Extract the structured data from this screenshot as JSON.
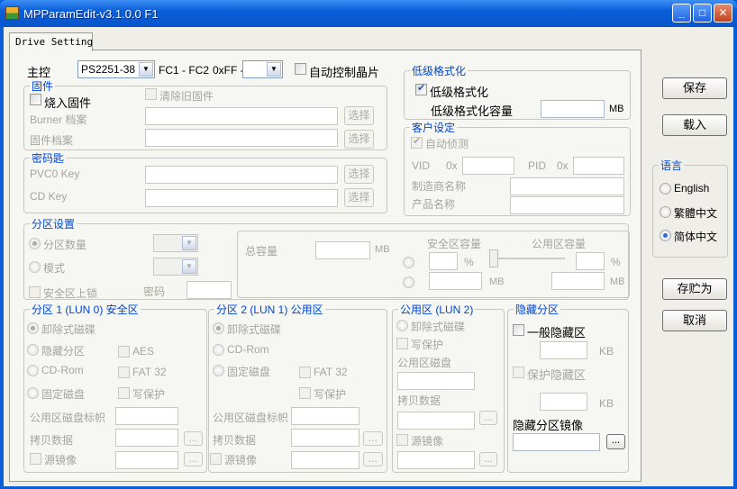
{
  "window": {
    "title": "MPParamEdit-v3.1.0.0 F1",
    "minimize": "_",
    "maximize": "□",
    "close": "✕"
  },
  "tab": "Drive Setting",
  "controller": {
    "label": "主控",
    "value": "PS2251-38",
    "fc_label": "FC1 - FC2",
    "ff_label": "0xFF -",
    "ff_value": "",
    "auto_chip": "自动控制晶片"
  },
  "firmware": {
    "title": "固件",
    "burn": "烧入固件",
    "clear": "清除旧固件",
    "burner_label": "Burner 档案",
    "fw_label": "固件档案",
    "select": "选择"
  },
  "key": {
    "title": "密码匙",
    "pvc0": "PVC0 Key",
    "cd": "CD Key",
    "select": "选择"
  },
  "lowformat": {
    "title": "低级格式化",
    "check": "低级格式化",
    "cap_label": "低级格式化容量",
    "unit": "MB",
    "checked": true
  },
  "customer": {
    "title": "客户设定",
    "auto": "自动侦测",
    "vid": "VID",
    "pid": "PID",
    "hex": "0x",
    "maker": "制造商名称",
    "product": "产品名称"
  },
  "buttons": {
    "save": "保存",
    "load": "载入",
    "saveas": "存贮为",
    "cancel": "取消"
  },
  "language": {
    "title": "语言",
    "options": [
      "English",
      "繁體中文",
      "简体中文"
    ],
    "selected": "简体中文"
  },
  "partition": {
    "title": "分区设置",
    "count": "分区数量",
    "mode": "模式",
    "lock": "安全区上锁",
    "password": "密码",
    "total": "总容量",
    "mb": "MB",
    "secure_cap": "安全区容量",
    "public_cap": "公用区容量",
    "pct": "%"
  },
  "p1": {
    "title": "分区 1 (LUN 0) 安全区",
    "removable": "卸除式磁碟",
    "hidden": "隐藏分区",
    "cdrom": "CD-Rom",
    "fixed": "固定磁盘",
    "aes": "AES",
    "fat32": "FAT 32",
    "wp": "写保护",
    "disk_label": "公用区磁盘标帜",
    "copy": "拷贝数据",
    "mirror": "源镜像",
    "dots": "..."
  },
  "p2": {
    "title": "分区 2 (LUN 1) 公用区",
    "removable": "卸除式磁碟",
    "cdrom": "CD-Rom",
    "fixed": "固定磁盘",
    "fat32": "FAT 32",
    "wp": "写保护",
    "disk_label": "公用区磁盘标帜",
    "copy": "拷贝数据",
    "mirror": "源镜像",
    "dots": "..."
  },
  "p3": {
    "title": "公用区 (LUN 2)",
    "removable": "卸除式磁碟",
    "wp": "写保护",
    "disk": "公用区磁盘",
    "copy": "拷贝数据",
    "mirror": "源镜像",
    "dots": "..."
  },
  "hidden": {
    "title": "隐藏分区",
    "normal": "一般隐藏区",
    "protect": "保护隐藏区",
    "kb": "KB",
    "image": "隐藏分区镜像",
    "dots": "..."
  }
}
